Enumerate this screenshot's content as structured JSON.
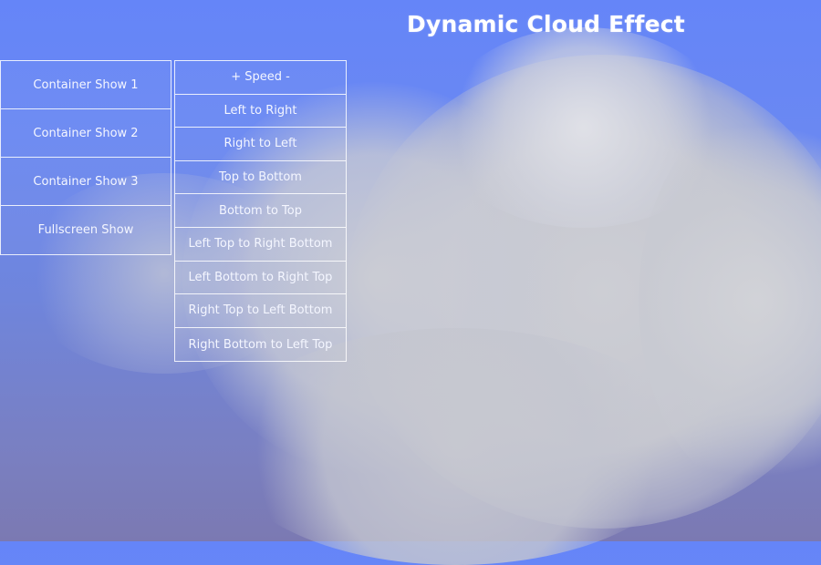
{
  "page": {
    "title": "Dynamic Cloud Effect"
  },
  "show_menu": {
    "items": [
      {
        "label": "Container Show 1"
      },
      {
        "label": "Container Show 2"
      },
      {
        "label": "Container Show 3"
      },
      {
        "label": "Fullscreen Show"
      }
    ]
  },
  "direction_menu": {
    "speed_label": "+ Speed -",
    "items": [
      {
        "label": "Left to Right"
      },
      {
        "label": "Right to Left"
      },
      {
        "label": "Top to Bottom"
      },
      {
        "label": "Bottom to Top"
      },
      {
        "label": "Left Top to Right Bottom"
      },
      {
        "label": "Left Bottom to Right Top"
      },
      {
        "label": "Right Top to Left Bottom"
      },
      {
        "label": "Right Bottom to Left Top"
      }
    ]
  },
  "colors": {
    "sky_top": "#6585f8",
    "sky_bottom": "#7b79b2",
    "cloud": "#c8c9cf"
  }
}
